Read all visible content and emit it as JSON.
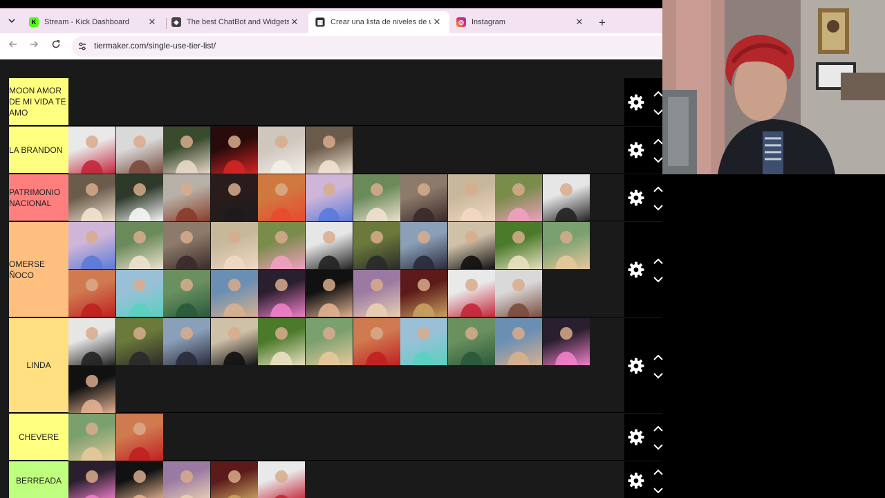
{
  "browser": {
    "tabs": [
      {
        "title": "Stream - Kick Dashboard",
        "favicon": "kick-icon",
        "color": "#53fc18",
        "active": false
      },
      {
        "title": "The best ChatBot and Widgets",
        "favicon": "botrix-icon",
        "color": "#444444",
        "active": false
      },
      {
        "title": "Crear una lista de niveles de un",
        "favicon": "tiermaker-icon",
        "color": "#2e2e2e",
        "active": true
      },
      {
        "title": "Instagram",
        "favicon": "instagram-icon",
        "color": "#e1306c",
        "active": false
      }
    ],
    "close_symbol": "✕",
    "new_tab_symbol": "+",
    "url": "tiermaker.com/single-use-tier-list/"
  },
  "tiers": [
    {
      "label": "MOON AMOR DE MI VIDA TE AMO",
      "color": "#ffff7f",
      "align": "left",
      "items": 0
    },
    {
      "label": "LA BRANDON",
      "color": "#ffff7f",
      "align": "left",
      "items": 6
    },
    {
      "label": "PATRIMONIO NACIONAL",
      "color": "#ff7f7f",
      "align": "left",
      "items": 11
    },
    {
      "label": "OMERSE ÑOCO",
      "color": "#ffbf7f",
      "align": "left",
      "items": 21
    },
    {
      "label": "LINDA",
      "color": "#ffdf7f",
      "align": "center",
      "items": 12
    },
    {
      "label": "CHEVERE",
      "color": "#ffff7f",
      "align": "center",
      "items": 2
    },
    {
      "label": "BERREADA",
      "color": "#bfff7f",
      "align": "center",
      "items": 5
    }
  ]
}
